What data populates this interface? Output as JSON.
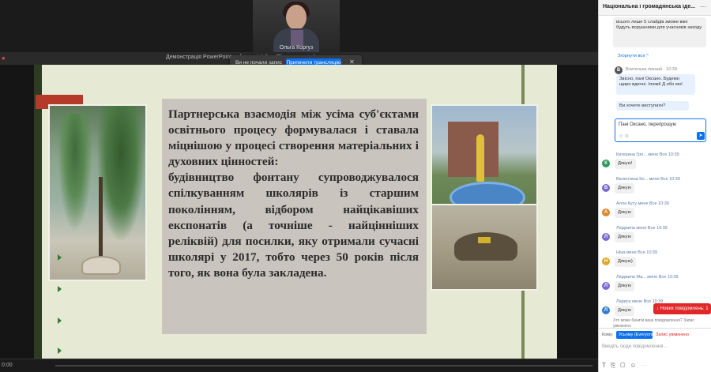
{
  "meeting": {
    "participant_name": "Ольга Коргуз",
    "share_title": "Демонстрація PowerPoint — [ваше ім'я] — (Вікно процесу)",
    "share_toast": {
      "text": "Ви не почали запис",
      "button": "Припинити трансляцію"
    },
    "bottom_time": "0:00"
  },
  "slide": {
    "body_text": "Партнерська взаємодія між усіма суб'єктами освітнього процесу формувалася і ставала міцнішою у процесі створення матеріальних і духовних цінностей:\nбудівництво фонтану супроводжувалося спілкуванням школярів із старшим поколінням, відбором найцікавіших експонатів (а точніше - найцінніших реліквій) для посилки, яку отримали сучасні школярі у 2017, тобто через 50 років після того, як вона була закладена."
  },
  "chat": {
    "title": "Національна і громадянська іде...",
    "top_bubble": "всього лише 5 слайдів зможе вже будуть ворушними для учасників заходу",
    "collapse_link": "Згорнути все ^",
    "reply": {
      "author": "Вчителька гімназії · 10:39",
      "bubble1": "Звісно, пані Оксано. Будемо щиро вдячні. Ілюмії Д обо мої",
      "bubble2": "Ви хочете виступати?"
    },
    "reply_input": "Пані Оксано, перепрошую",
    "messages": [
      {
        "initial": "К",
        "color": "#2e9a5e",
        "author": "Катерина Гро... мене  Все 10:39",
        "text": "Дякую!"
      },
      {
        "initial": "В",
        "color": "#7a6ad2",
        "author": "Валентина Ко... мене Все 10:39",
        "text": "Дякую"
      },
      {
        "initial": "А",
        "color": "#e0852a",
        "author": "Алла Кусу  мене Все 10:39",
        "text": "Дякую"
      },
      {
        "initial": "Л",
        "color": "#7a6ad2",
        "author": "Людмила  мене Все 10:39",
        "text": "Дякую"
      },
      {
        "initial": "Н",
        "color": "#e0a52a",
        "author": "Ніна  мене Все 10:39",
        "text": "Дякую)"
      },
      {
        "initial": "Л",
        "color": "#7a6ad2",
        "author": "Людмила Ма... мене Все 10:39",
        "text": "Дякую"
      },
      {
        "initial": "Л",
        "color": "#2e7dd2",
        "author": "Лариса  мене Все 10:39",
        "text": "Дякую"
      }
    ],
    "new_messages": "↓ Нових повідомлень: 1",
    "footnote": "Хто може бачити ваші повідомлення? Запис увімкнено",
    "composer": {
      "to_label": "Кому:",
      "to_value": "Усьому (Everyone) ▾",
      "warning": "Запис увімкнено",
      "placeholder": "Введіть сюди повідомлення..."
    }
  }
}
